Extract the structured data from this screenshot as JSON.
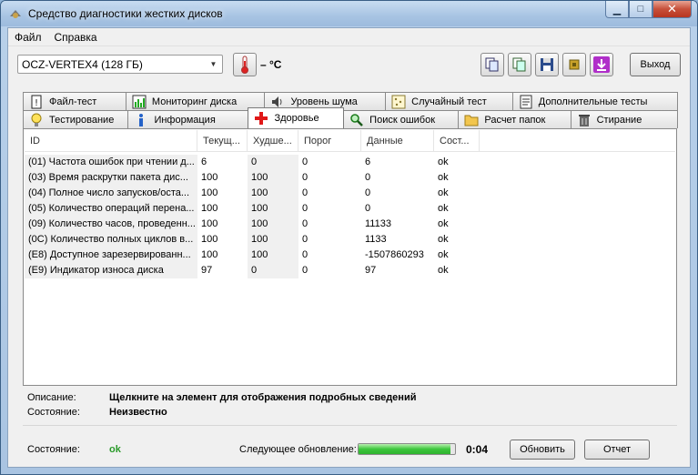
{
  "window": {
    "title": "Средство диагностики жестких дисков"
  },
  "menu": [
    {
      "label": "Файл"
    },
    {
      "label": "Справка"
    }
  ],
  "toolbar": {
    "drive": "OCZ-VERTEX4 (128 ГБ)",
    "temperature": "– °C",
    "exit_label": "Выход",
    "icons": [
      "copy-icon",
      "copy-all-icon",
      "save-icon",
      "chip-icon",
      "download-icon"
    ]
  },
  "tabs_row1": [
    {
      "label": "Файл-тест",
      "icon": "file-test-icon"
    },
    {
      "label": "Мониторинг диска",
      "icon": "chart-icon"
    },
    {
      "label": "Уровень шума",
      "icon": "speaker-icon"
    },
    {
      "label": "Случайный тест",
      "icon": "random-icon"
    },
    {
      "label": "Дополнительные тесты",
      "icon": "extra-tests-icon"
    }
  ],
  "tabs_row2": [
    {
      "label": "Тестирование",
      "icon": "bulb-icon"
    },
    {
      "label": "Информация",
      "icon": "info-icon"
    },
    {
      "label": "Здоровье",
      "icon": "red-cross-icon",
      "active": true
    },
    {
      "label": "Поиск ошибок",
      "icon": "magnifier-icon"
    },
    {
      "label": "Расчет папок",
      "icon": "folder-icon"
    },
    {
      "label": "Стирание",
      "icon": "trash-icon"
    }
  ],
  "table": {
    "headers": [
      "ID",
      "Текущ...",
      "Худше...",
      "Порог",
      "Данные",
      "Сост..."
    ],
    "rows": [
      [
        "(01) Частота ошибок при чтении д...",
        "6",
        "0",
        "0",
        "6",
        "ok"
      ],
      [
        "(03) Время раскрутки пакета дис...",
        "100",
        "100",
        "0",
        "0",
        "ok"
      ],
      [
        "(04) Полное число запусков/оста...",
        "100",
        "100",
        "0",
        "0",
        "ok"
      ],
      [
        "(05) Количество операций перена...",
        "100",
        "100",
        "0",
        "0",
        "ok"
      ],
      [
        "(09) Количество часов, проведенн...",
        "100",
        "100",
        "0",
        "11133",
        "ok"
      ],
      [
        "(0C) Количество полных циклов в...",
        "100",
        "100",
        "0",
        "1133",
        "ok"
      ],
      [
        "(E8) Доступное зарезервированн...",
        "100",
        "100",
        "0",
        "-1507860293",
        "ok"
      ],
      [
        "(E9) Индикатор износа диска",
        "97",
        "0",
        "0",
        "97",
        "ok"
      ]
    ]
  },
  "details": {
    "description_label": "Описание:",
    "description_value": "Щелкните на элемент для отображения подробных сведений",
    "state_label": "Состояние:",
    "state_value": "Неизвестно"
  },
  "footer": {
    "status_label": "Состояние:",
    "status_value": "ok",
    "next_update_label": "Следующее обновление:",
    "progress": 0.95,
    "countdown": "0:04",
    "refresh_label": "Обновить",
    "report_label": "Отчет"
  }
}
